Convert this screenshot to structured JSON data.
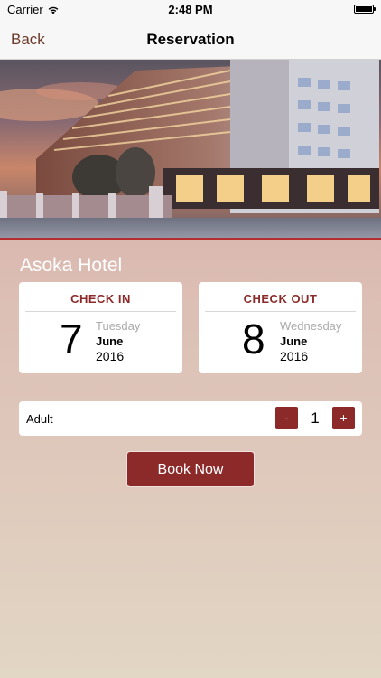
{
  "status_bar": {
    "carrier": "Carrier",
    "time": "2:48 PM",
    "icons": [
      "wifi-icon",
      "battery-icon"
    ]
  },
  "nav": {
    "back_label": "Back",
    "title": "Reservation"
  },
  "hotel": {
    "name": "Asoka Hotel",
    "image": "hotel-building-photo"
  },
  "check_in": {
    "title": "CHECK IN",
    "day": "7",
    "weekday": "Tuesday",
    "month": "June",
    "year": "2016"
  },
  "check_out": {
    "title": "CHECK OUT",
    "day": "8",
    "weekday": "Wednesday",
    "month": "June",
    "year": "2016"
  },
  "guests": {
    "label": "Adult",
    "count": "1",
    "minus_label": "-",
    "plus_label": "+"
  },
  "actions": {
    "book_label": "Book Now"
  },
  "colors": {
    "accent": "#8c2a2a",
    "nav_back": "#6b3a2a",
    "bg_top": "#d4a19f",
    "bg_bottom": "#e2d6c4"
  }
}
